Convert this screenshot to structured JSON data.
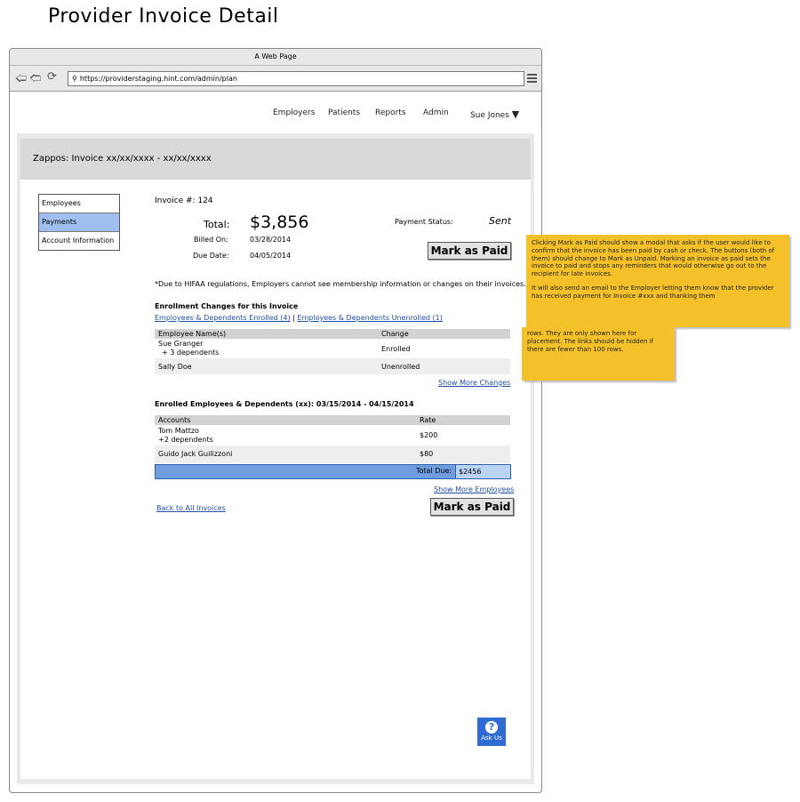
{
  "page_title": "Provider Invoice Detail",
  "browser": {
    "window_title": "A Web Page",
    "url": "https://providerstaging.hint.com/admin/plan"
  },
  "topnav": {
    "items": [
      "Employers",
      "Patients",
      "Reports",
      "Admin"
    ],
    "user": "Sue Jones"
  },
  "header_band": "Zappos: Invoice xx/xx/xxxx - xx/xx/xxxx",
  "sidebar": {
    "items": [
      {
        "label": "Employees",
        "selected": false
      },
      {
        "label": "Payments",
        "selected": true
      },
      {
        "label": "Account Information",
        "selected": false
      }
    ]
  },
  "invoice": {
    "number_label": "Invoice #: 124",
    "total_label": "Total:",
    "total_value": "$3,856",
    "billed_on_label": "Billed On:",
    "billed_on_value": "03/28/2014",
    "due_date_label": "Due Date:",
    "due_date_value": "04/05/2014",
    "payment_status_label": "Payment Status:",
    "payment_status_value": "Sent",
    "mark_paid_label": "Mark as Paid",
    "hipaa_note": "*Due to HIFAA regulations, Employers cannot see membership information or changes on their invoices."
  },
  "enrollment_changes": {
    "heading": "Enrollment Changes for this Invoice",
    "link_enrolled": "Employees & Dependents Enrolled (4)",
    "separator": "|",
    "link_unenrolled": "Employees & Dependents Unenrolled (1)",
    "columns": [
      "Employee Name(s)",
      "Change"
    ],
    "rows": [
      {
        "name": "Sue Granger",
        "sub": "+ 3 dependents",
        "change": "Enrolled"
      },
      {
        "name": "Sally Doe",
        "sub": "",
        "change": "Unenrolled"
      }
    ],
    "show_more": "Show More Changes"
  },
  "enrolled": {
    "heading": "Enrolled Employees & Dependents (xx): 03/15/2014 - 04/15/2014",
    "columns": [
      "Accounts",
      "Rate"
    ],
    "rows": [
      {
        "name": "Tom Mattzo",
        "sub": "+2 dependents",
        "rate": "$200"
      },
      {
        "name": "Guido Jack Guilizzoni",
        "sub": "",
        "rate": "$80"
      }
    ],
    "total_label": "Total Due:",
    "total_value": "$2456",
    "show_more": "Show More Employees"
  },
  "back_link": "Back to All Invoices",
  "mark_paid_bottom": "Mark as Paid",
  "ask": {
    "symbol": "?",
    "label": "Ask Us"
  },
  "note": {
    "para1": "Clicking Mark as Paid should show a modal that asks if the user would like to confirm that the invoice has been paid by cash or check. The buttons (both of them) should change to Mark as Unpaid. Marking an invoice as paid sets the invoice to paid and stops any reminders that would otherwise go out to the recipient for late invoices.",
    "para2": "It will also send an email to the Employer letting them know that the provider has received payment for Invoice #xxx and thanking them",
    "para3": "rows. They are only shown here for placement. The links should be hidden if there are fewer than 100 rows."
  },
  "colors": {
    "selected": "#9fc0ef",
    "total_row": "#6f9ede",
    "note": "#f4c12a",
    "ask": "#2f6bd0"
  }
}
